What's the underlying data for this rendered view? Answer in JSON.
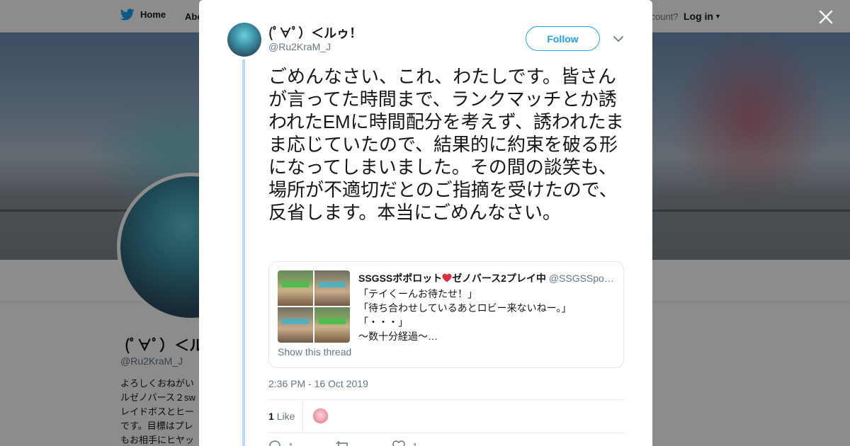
{
  "nav": {
    "home_label": "Home",
    "about_label": "Abo",
    "account_text": "ccount?",
    "login_label": "Log in"
  },
  "profile_bg": {
    "name": "(ﾟ∀ﾟ）＜ル",
    "handle": "@Ru2KraM_J",
    "bio_lines": [
      "よろしくおねがい",
      "ルゼノバース２sw",
      "レイドボスとヒー",
      "です。目標はプレ",
      "もお相手にヒヤッ"
    ]
  },
  "tweet": {
    "author_name": "(ﾟ∀ﾟ）＜ルゥ！",
    "author_handle": "@Ru2KraM_J",
    "follow_label": "Follow",
    "text": "ごめんなさい、これ、わたしです。皆さんが言ってた時間まで、ランクマッチとか誘われたEMに時間配分を考えず、誘われたまま応じていたので、結果的に約束を破る形になってしまいました。その間の談笑も、場所が不適切だとのご指摘を受けたので、反省します。本当にごめんなさい。",
    "timestamp": "2:36 PM - 16 Oct 2019",
    "like_count": "1",
    "like_label": "Like",
    "reply_count": "1",
    "heart_count": "1"
  },
  "quote": {
    "author_name_part1": "SSGSSポポロット",
    "author_name_part2": "ゼノバース2プレイ中",
    "author_handle": "@SSGSSpo…",
    "lines": [
      "「テイくーんお待たせ！」",
      "「待ち合わせしているあとロビー来ないねー。」",
      "「・・・」",
      "～数十分経過～…"
    ],
    "show_thread": "Show this thread"
  },
  "colors": {
    "accent": "#1da1f2",
    "thread_line": "#b6dcf2",
    "text_primary": "#14171a",
    "text_secondary": "#657786",
    "heart": "#e0245e"
  }
}
